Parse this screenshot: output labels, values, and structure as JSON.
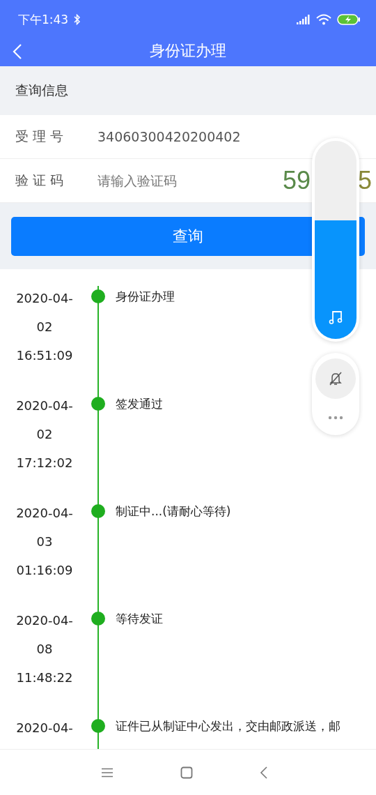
{
  "status_bar": {
    "time": "下午1:43"
  },
  "header": {
    "title": "身份证办理"
  },
  "section": {
    "title": "查询信息"
  },
  "form": {
    "fields": [
      {
        "label": "受 理 号",
        "value": "34060300420200402"
      },
      {
        "label": "验 证 码",
        "placeholder": "请输入验证码"
      }
    ],
    "captcha": {
      "visible_start": "59",
      "visible_end": "5"
    },
    "submit": "查询"
  },
  "timeline": [
    {
      "date": "2020-04-",
      "day": "02",
      "time": "16:51:09",
      "status": "身份证办理"
    },
    {
      "date": "2020-04-",
      "day": "02",
      "time": "17:12:02",
      "status": "签发通过"
    },
    {
      "date": "2020-04-",
      "day": "03",
      "time": "01:16:09",
      "status": "制证中...(请耐心等待)"
    },
    {
      "date": "2020-04-",
      "day": "08",
      "time": "11:48:22",
      "status": "等待发证"
    },
    {
      "date": "2020-04-",
      "status": "证件已从制证中心发出，交由邮政派送，邮"
    }
  ],
  "volume_panel": {
    "level": 0.6
  }
}
